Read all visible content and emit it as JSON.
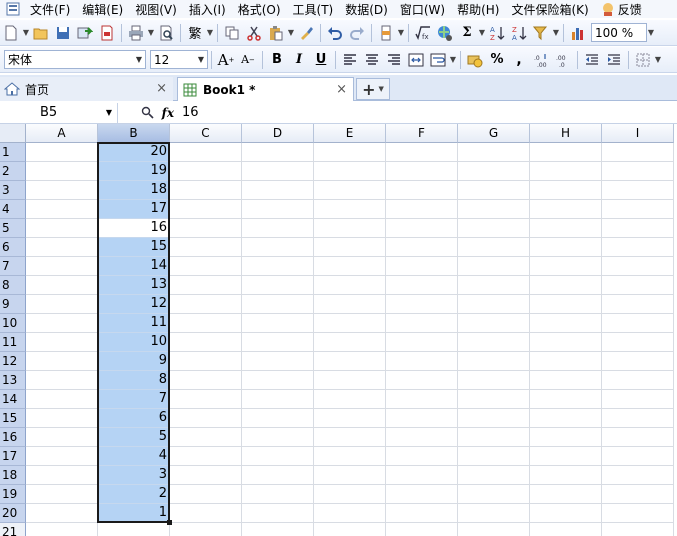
{
  "menubar": {
    "items": [
      "文件(F)",
      "编辑(E)",
      "视图(V)",
      "插入(I)",
      "格式(O)",
      "工具(T)",
      "数据(D)",
      "窗口(W)",
      "帮助(H)",
      "文件保险箱(K)"
    ],
    "feedback_label": "反馈"
  },
  "toolbar": {
    "traditional_label": "繁",
    "sum_label": "Σ",
    "zoom": "100 %"
  },
  "format": {
    "font_name": "宋体",
    "font_size": "12",
    "grow_label": "A",
    "shrink_label": "A",
    "bold_label": "B",
    "italic_label": "I",
    "underline_label": "U",
    "percent_label": "%",
    "comma_label": ","
  },
  "tabs": {
    "home_label": "首页",
    "book_label": "Book1 *",
    "close_glyph": "×",
    "new_glyph": "+"
  },
  "formula_bar": {
    "cell_ref": "B5",
    "fx_label": "fx",
    "value": "16"
  },
  "sheet": {
    "columns": [
      "A",
      "B",
      "C",
      "D",
      "E",
      "F",
      "G",
      "H",
      "I"
    ],
    "rows": [
      "1",
      "2",
      "3",
      "4",
      "5",
      "6",
      "7",
      "8",
      "9",
      "10",
      "11",
      "12",
      "13",
      "14",
      "15",
      "16",
      "17",
      "18",
      "19",
      "20",
      "21"
    ],
    "column_b_values": [
      "20",
      "19",
      "18",
      "17",
      "16",
      "15",
      "14",
      "13",
      "12",
      "11",
      "10",
      "9",
      "8",
      "7",
      "6",
      "5",
      "4",
      "3",
      "2",
      "1"
    ],
    "selected_column": "B",
    "active_row": "5",
    "selection_color": "#b5d3f4",
    "header_selected_color": "#c7d5ee"
  }
}
